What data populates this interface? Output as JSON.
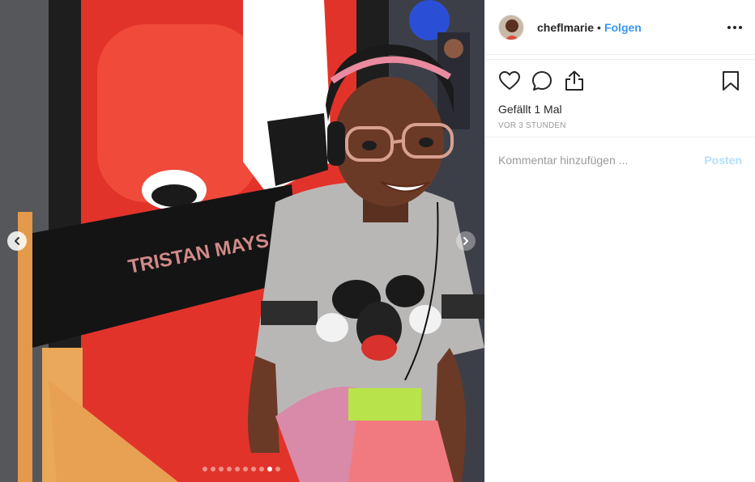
{
  "photo": {
    "chair_text": "TRISTAN MAYS",
    "slide_count": 10,
    "active_slide": 9
  },
  "post": {
    "username": "cheflmarie",
    "separator": "•",
    "follow_label": "Folgen",
    "likes_text": "Gefällt 1 Mal",
    "time_text": "VOR 3 STUNDEN",
    "comment_placeholder": "Kommentar hinzufügen ...",
    "post_label": "Posten"
  },
  "icons": {
    "like": "heart-icon",
    "comment": "comment-icon",
    "share": "share-icon",
    "save": "bookmark-icon",
    "options": "more-options-icon",
    "prev": "chevron-left-icon",
    "next": "chevron-right-icon"
  },
  "colors": {
    "link": "#3897f0",
    "post_disabled": "#b2dffc",
    "muted": "#999999",
    "text": "#262626"
  }
}
